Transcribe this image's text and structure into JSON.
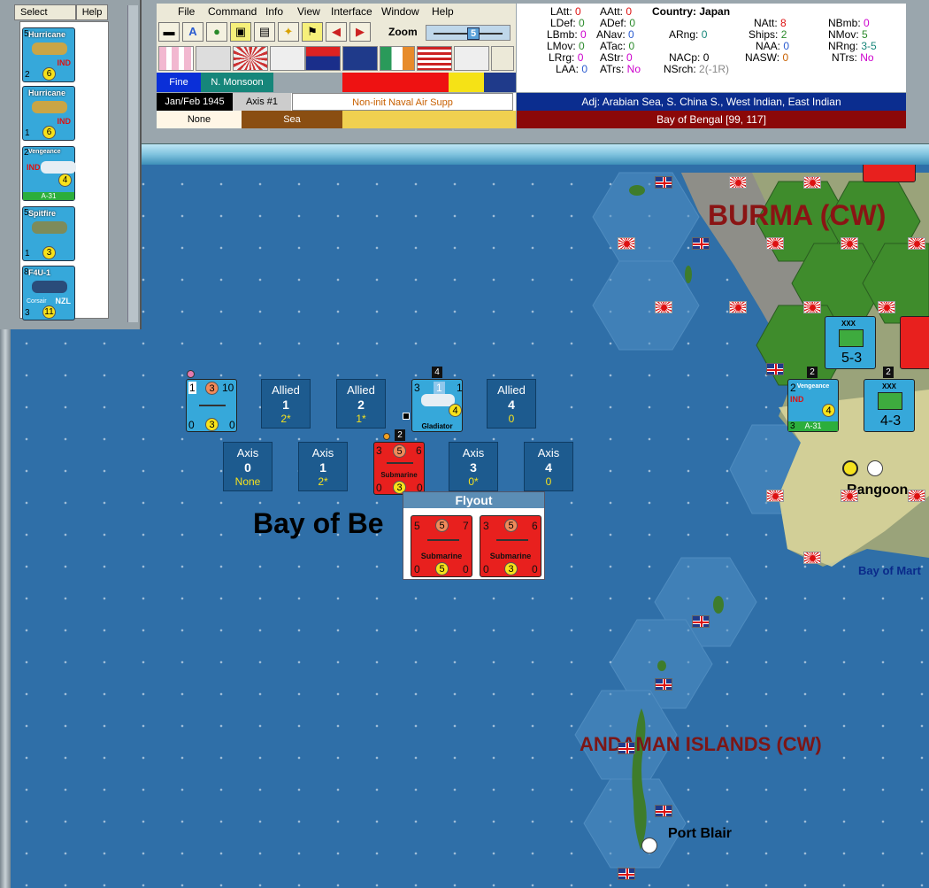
{
  "menu": {
    "file": "File",
    "command": "Command",
    "info": "Info",
    "view": "View",
    "interface": "Interface",
    "window": "Window",
    "help": "Help"
  },
  "toolbar": {
    "zoom_label": "Zoom",
    "zoom_value": "5"
  },
  "left_panel": {
    "select_label": "Select",
    "help_label": "Help",
    "cards": [
      {
        "name": "Hurricane",
        "sub": "XII",
        "top": "5",
        "nation": "IND",
        "bl": "2",
        "circle": "6",
        "bar": ""
      },
      {
        "name": "Hurricane",
        "sub": "XII",
        "top": "",
        "nation": "IND",
        "bl": "1",
        "circle": "6",
        "bar": ""
      },
      {
        "name": "Vengeance",
        "sub": "",
        "top": "2",
        "nation": "IND",
        "bl": "3",
        "circle": "4",
        "bar": "A-31"
      },
      {
        "name": "Spitfire",
        "sub": "",
        "top": "5",
        "nation": "",
        "bl": "1",
        "circle": "3",
        "bar": ""
      },
      {
        "name": "F4U-1",
        "sub": "Corsair",
        "top": "8",
        "nation": "NZL",
        "bl": "3",
        "circle": "11",
        "bar": ""
      }
    ]
  },
  "status": {
    "date": "Jan/Feb 1945",
    "turn": "Axis #1",
    "phase": "Non-init Naval Air Supp",
    "weather": "Fine",
    "weather_zone": "N. Monsoon",
    "terrain_none": "None",
    "terrain_sea": "Sea"
  },
  "info": {
    "country_label": "Country:",
    "country": "Japan",
    "stats": [
      {
        "k": "LAtt:",
        "v": "0"
      },
      {
        "k": "LDef:",
        "v": "0"
      },
      {
        "k": "LBmb:",
        "v": "0"
      },
      {
        "k": "LMov:",
        "v": "0"
      },
      {
        "k": "LRrg:",
        "v": "0"
      },
      {
        "k": "LAA:",
        "v": "0"
      },
      {
        "k": "AAtt:",
        "v": "0"
      },
      {
        "k": "ADef:",
        "v": "0"
      },
      {
        "k": "ANav:",
        "v": "0"
      },
      {
        "k": "ATac:",
        "v": "0"
      },
      {
        "k": "AStr:",
        "v": "0"
      },
      {
        "k": "ATrs:",
        "v": "No"
      },
      {
        "k": "ARng:",
        "v": "0"
      },
      {
        "k": "NACp:",
        "v": "0"
      },
      {
        "k": "NSrch:",
        "v": "2(-1R)"
      },
      {
        "k": "NAtt:",
        "v": "8"
      },
      {
        "k": "Ships:",
        "v": "2"
      },
      {
        "k": "NAA:",
        "v": "0"
      },
      {
        "k": "NASW:",
        "v": "0"
      },
      {
        "k": "NBmb:",
        "v": "0"
      },
      {
        "k": "NMov:",
        "v": "5"
      },
      {
        "k": "NRng:",
        "v": "3-5"
      },
      {
        "k": "NTrs:",
        "v": "No"
      }
    ],
    "adjacent": "Adj: Arabian Sea, S. China S., West Indian, East Indian",
    "hex": "Bay of Bengal [99, 117]"
  },
  "map": {
    "labels": {
      "burma": "BURMA (CW)",
      "bay_of_bengal": "Bay of Be",
      "andaman": "ANDAMAN ISLANDS (CW)",
      "rangoon": "Rangoon",
      "port_blair": "Port Blair",
      "bay_of_martaban": "Bay of Mart"
    },
    "search_slots": {
      "allied": [
        {
          "label": "Allied",
          "num": "1",
          "val": "2*"
        },
        {
          "label": "Allied",
          "num": "2",
          "val": "1*"
        },
        {
          "label": "Allied",
          "num": "4",
          "val": "0"
        }
      ],
      "axis": [
        {
          "label": "Axis",
          "num": "0",
          "val": "None"
        },
        {
          "label": "Axis",
          "num": "1",
          "val": "2*"
        },
        {
          "label": "Axis",
          "num": "3",
          "val": "0*"
        },
        {
          "label": "Axis",
          "num": "4",
          "val": "0"
        }
      ]
    },
    "units": {
      "convoy": {
        "a": "1",
        "b": "3",
        "c": "10",
        "d": "0",
        "e": "3",
        "f": "0"
      },
      "gladiator": {
        "name": "Gladiator",
        "top": "3",
        "mid": "1",
        "right": "1",
        "circle": "4",
        "stack": "4"
      },
      "submarine_main": {
        "name": "Submarine",
        "a": "3",
        "b": "5",
        "c": "6",
        "d": "0",
        "e": "3",
        "f": "0",
        "stack": "2"
      },
      "vengeance_map": {
        "name": "Vengeance",
        "top": "2",
        "nation": "IND",
        "circle": "4",
        "bar": "A-31",
        "bl": "3",
        "stack": "2"
      },
      "burma_corps_1": {
        "top": "XXX",
        "val": "5-3"
      },
      "burma_corps_2": {
        "top": "XXX",
        "val": "4-3",
        "stack": "2"
      }
    },
    "flyout": {
      "title": "Flyout",
      "units": [
        {
          "name": "Submarine",
          "a": "5",
          "b": "5",
          "c": "7",
          "d": "0",
          "e": "5",
          "f": "0"
        },
        {
          "name": "Submarine",
          "a": "3",
          "b": "5",
          "c": "6",
          "d": "0",
          "e": "3",
          "f": "0"
        }
      ]
    }
  }
}
